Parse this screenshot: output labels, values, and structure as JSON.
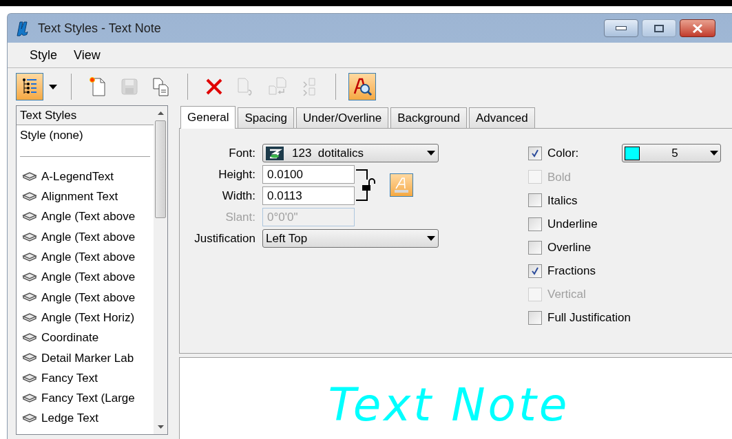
{
  "window": {
    "title": "Text Styles - Text Note"
  },
  "menu": [
    {
      "label": "Style"
    },
    {
      "label": "View"
    }
  ],
  "toolbar": [
    {
      "kind": "button",
      "active": true,
      "disabled": false,
      "dropdown": true
    },
    {
      "kind": "separator"
    },
    {
      "kind": "button",
      "active": false,
      "disabled": false,
      "dropdown": false
    },
    {
      "kind": "button",
      "active": false,
      "disabled": true,
      "dropdown": false
    },
    {
      "kind": "button",
      "active": false,
      "disabled": false,
      "dropdown": false
    },
    {
      "kind": "separator"
    },
    {
      "kind": "button",
      "active": false,
      "disabled": false,
      "dropdown": false
    },
    {
      "kind": "button",
      "active": false,
      "disabled": true,
      "dropdown": false
    },
    {
      "kind": "button",
      "active": false,
      "disabled": true,
      "dropdown": false
    },
    {
      "kind": "button",
      "active": false,
      "disabled": true,
      "dropdown": false
    },
    {
      "kind": "separator"
    },
    {
      "kind": "button",
      "active": true,
      "disabled": false,
      "dropdown": false
    }
  ],
  "style_list": {
    "header": "Text Styles",
    "none_item": "Style (none)",
    "items": [
      {
        "label": "A-LegendText",
        "selected": false
      },
      {
        "label": "Alignment Text",
        "selected": false
      },
      {
        "label": "Angle (Text above",
        "selected": false
      },
      {
        "label": "Angle (Text above",
        "selected": false
      },
      {
        "label": "Angle (Text above",
        "selected": false
      },
      {
        "label": "Angle (Text above",
        "selected": false
      },
      {
        "label": "Angle (Text above",
        "selected": false
      },
      {
        "label": "Angle (Text Horiz)",
        "selected": false
      },
      {
        "label": "Coordinate",
        "selected": false
      },
      {
        "label": "Detail Marker Lab",
        "selected": false
      },
      {
        "label": "Fancy Text",
        "selected": false
      },
      {
        "label": "Fancy Text (Large",
        "selected": false
      },
      {
        "label": "Ledge Text",
        "selected": false
      }
    ]
  },
  "tabs": [
    {
      "label": "General",
      "selected": true
    },
    {
      "label": "Spacing",
      "selected": false
    },
    {
      "label": "Under/Overline",
      "selected": false
    },
    {
      "label": "Background",
      "selected": false
    },
    {
      "label": "Advanced",
      "selected": false
    }
  ],
  "general": {
    "font": {
      "label": "Font:",
      "value": "123  dotitalics"
    },
    "height": {
      "label": "Height:",
      "value": "0.0100"
    },
    "width": {
      "label": "Width:",
      "value": "0.0113"
    },
    "slant": {
      "label": "Slant:",
      "value": "0°0'0\"",
      "disabled": true
    },
    "aspect_locked": false,
    "justification": {
      "label": "Justification",
      "value": "Left Top"
    },
    "color": {
      "label": "Color:",
      "checked": true,
      "value": "5",
      "color": "#00ffff"
    },
    "options": [
      {
        "label": "Bold",
        "checked": false,
        "disabled": true
      },
      {
        "label": "Italics",
        "checked": false,
        "disabled": false
      },
      {
        "label": "Underline",
        "checked": false,
        "disabled": false
      },
      {
        "label": "Overline",
        "checked": false,
        "disabled": false
      },
      {
        "label": "Fractions",
        "checked": true,
        "disabled": false
      },
      {
        "label": "Vertical",
        "checked": false,
        "disabled": true
      },
      {
        "label": "Full Justification",
        "checked": false,
        "disabled": false
      }
    ]
  },
  "preview": {
    "text": "Text Note"
  }
}
